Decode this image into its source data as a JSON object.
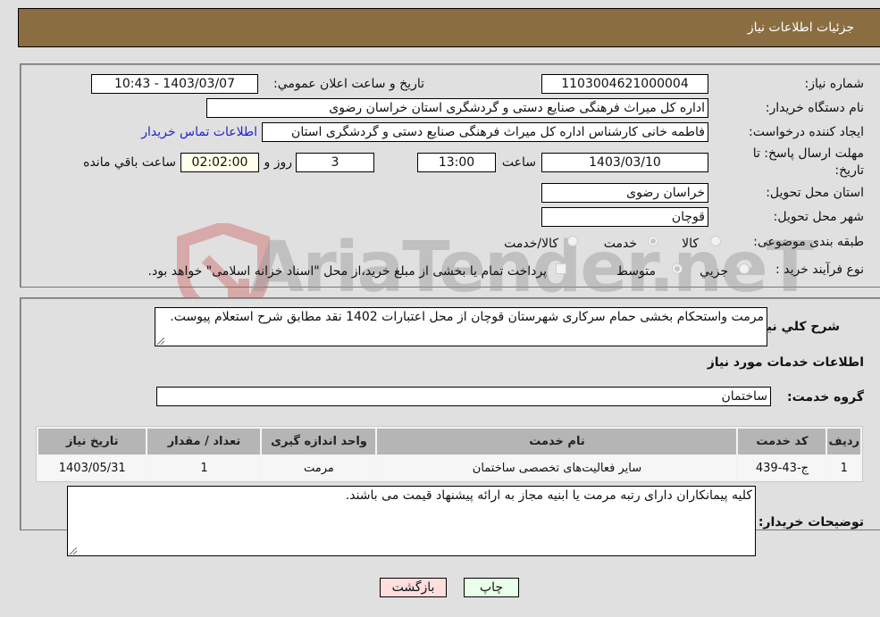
{
  "header": {
    "title": "جزئیات اطلاعات نیاز"
  },
  "fields": {
    "need_number": {
      "label": "شماره نیاز:",
      "value": "1103004621000004"
    },
    "announce_datetime": {
      "label": "تاریخ و ساعت اعلان عمومي:",
      "value": "1403/03/07 - 10:43"
    },
    "buyer_org": {
      "label": "نام دستگاه خريدار:",
      "value": "اداره کل میراث فرهنگی  صنایع دستی و گردشگری استان خراسان رضوی"
    },
    "requester": {
      "label": "ایجاد کننده درخواست:",
      "value": "فاطمه خانی کارشناس اداره کل میراث فرهنگی  صنایع دستی و گردشگری استان"
    },
    "buyer_contact_link": "اطلاعات تماس خریدار",
    "deadline": {
      "label": "مهلت ارسال پاسخ: تا تاریخ:",
      "date": "1403/03/10",
      "time_label": "ساعت",
      "time": "13:00",
      "days": "3",
      "days_label": "روز و",
      "remaining": "02:02:00",
      "remaining_label": "ساعت باقي مانده"
    },
    "province": {
      "label": "استان محل تحویل:",
      "value": "خراسان رضوی"
    },
    "city": {
      "label": "شهر محل تحویل:",
      "value": "قوچان"
    },
    "category": {
      "label": "طبقه بندی موضوعی:",
      "options": [
        "کالا",
        "خدمت",
        "کالا/خدمت"
      ],
      "selected": "خدمت"
    },
    "purchase_type": {
      "label": "نوع فرآیند خرید :",
      "options": [
        "جزيي",
        "متوسط"
      ],
      "selected": "متوسط",
      "treasury_note": "پرداخت تمام یا بخشی از مبلغ خرید،از محل \"اسناد خزانه اسلامی\" خواهد بود."
    }
  },
  "description": {
    "label": "شرح کلي نياز:",
    "value": "مرمت واستحکام بخشی حمام سرکاری شهرستان قوچان از محل اعتبارات 1402 نقد مطابق شرح استعلام پیوست."
  },
  "services_section_title": "اطلاعات خدمات مورد نياز",
  "service_group": {
    "label": "گروه خدمت:",
    "value": "ساختمان"
  },
  "table": {
    "headers": [
      "رديف",
      "کد خدمت",
      "نام خدمت",
      "واحد اندازه گیری",
      "تعداد / مقدار",
      "تاریخ نیاز"
    ],
    "rows": [
      [
        "1",
        "ج-43-439",
        "سایر فعالیت‌های تخصصی ساختمان",
        "مرمت",
        "1",
        "1403/05/31"
      ]
    ]
  },
  "buyer_notes": {
    "label": "توضیحات خریدار:",
    "value": "کلیه  پیمانکاران دارای رتبه مرمت یا ابنیه مجاز به ارائه پیشنهاد قیمت می باشند."
  },
  "buttons": {
    "print": "چاپ",
    "back": "بازگشت"
  },
  "watermark": "AriaTender.neT",
  "colors": {
    "header_bg": "#8b6d42",
    "link": "#2323cc",
    "print_bg": "#eaffea",
    "back_bg": "#ffdede",
    "remaining_bg": "#ffffea"
  }
}
